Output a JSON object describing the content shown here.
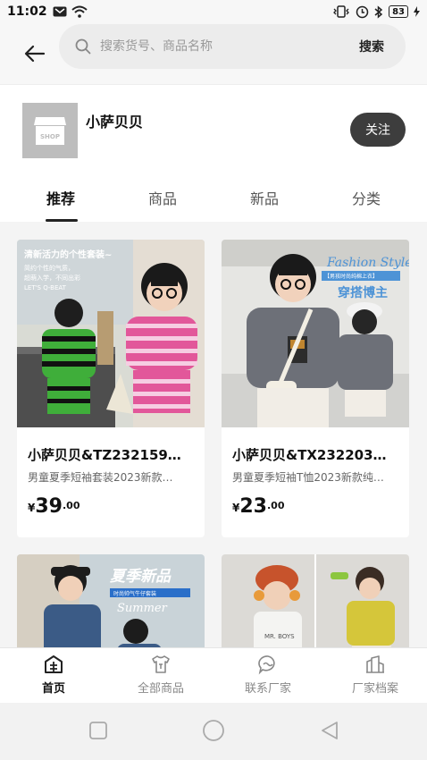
{
  "status_bar": {
    "time": "11:02",
    "battery": "83"
  },
  "search": {
    "placeholder": "搜索货号、商品名称",
    "button_label": "搜索"
  },
  "shop": {
    "logo_text": "SHOP",
    "name": "小萨贝贝",
    "follow_label": "关注"
  },
  "tabs": [
    {
      "label": "推荐",
      "active": true
    },
    {
      "label": "商品",
      "active": false
    },
    {
      "label": "新品",
      "active": false
    },
    {
      "label": "分类",
      "active": false
    }
  ],
  "products": [
    {
      "title": "小萨贝贝&TZ232159…",
      "subtitle": "男童夏季短袖套装2023新款…",
      "price_currency": "¥",
      "price_int": "39",
      "price_dec": ".00",
      "image": {
        "caption_top": "清新活力的个性套装~",
        "caption_lines": [
          "简约个性的气质，",
          "超萌入学，不同出彩",
          "LET'S Q-BEAT"
        ]
      }
    },
    {
      "title": "小萨贝贝&TX232203…",
      "subtitle": "男童夏季短袖T恤2023新款纯…",
      "price_currency": "¥",
      "price_int": "23",
      "price_dec": ".00",
      "image": {
        "caption_top": "Fashion Style",
        "caption_sub": "穿搭博主",
        "caption_tag": "【男孩时尚纯棉上衣】"
      }
    },
    {
      "image": {
        "caption_top": "夏季新品",
        "caption_sub": "Summer",
        "caption_tag": "时尚帅气牛仔套装"
      }
    },
    {
      "image": {
        "caption_top": "MR. BOYS"
      }
    }
  ],
  "bottom_nav": [
    {
      "label": "首页",
      "icon": "home-icon",
      "active": true
    },
    {
      "label": "全部商品",
      "icon": "shirt-icon",
      "active": false
    },
    {
      "label": "联系厂家",
      "icon": "chat-icon",
      "active": false
    },
    {
      "label": "厂家档案",
      "icon": "building-icon",
      "active": false
    }
  ],
  "colors": {
    "follow_bg": "#3d3d3d",
    "card_bg": "#ffffff",
    "page_bg": "#f4f4f4",
    "pink_stripe": "#e2579a",
    "green_stripe": "#3fae3a"
  }
}
